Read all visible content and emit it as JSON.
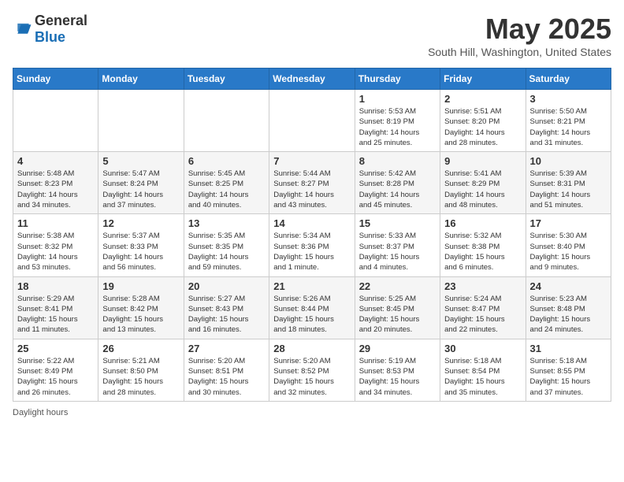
{
  "header": {
    "logo_general": "General",
    "logo_blue": "Blue",
    "month_title": "May 2025",
    "location": "South Hill, Washington, United States"
  },
  "days_of_week": [
    "Sunday",
    "Monday",
    "Tuesday",
    "Wednesday",
    "Thursday",
    "Friday",
    "Saturday"
  ],
  "weeks": [
    [
      {
        "day": "",
        "info": ""
      },
      {
        "day": "",
        "info": ""
      },
      {
        "day": "",
        "info": ""
      },
      {
        "day": "",
        "info": ""
      },
      {
        "day": "1",
        "info": "Sunrise: 5:53 AM\nSunset: 8:19 PM\nDaylight: 14 hours\nand 25 minutes."
      },
      {
        "day": "2",
        "info": "Sunrise: 5:51 AM\nSunset: 8:20 PM\nDaylight: 14 hours\nand 28 minutes."
      },
      {
        "day": "3",
        "info": "Sunrise: 5:50 AM\nSunset: 8:21 PM\nDaylight: 14 hours\nand 31 minutes."
      }
    ],
    [
      {
        "day": "4",
        "info": "Sunrise: 5:48 AM\nSunset: 8:23 PM\nDaylight: 14 hours\nand 34 minutes."
      },
      {
        "day": "5",
        "info": "Sunrise: 5:47 AM\nSunset: 8:24 PM\nDaylight: 14 hours\nand 37 minutes."
      },
      {
        "day": "6",
        "info": "Sunrise: 5:45 AM\nSunset: 8:25 PM\nDaylight: 14 hours\nand 40 minutes."
      },
      {
        "day": "7",
        "info": "Sunrise: 5:44 AM\nSunset: 8:27 PM\nDaylight: 14 hours\nand 43 minutes."
      },
      {
        "day": "8",
        "info": "Sunrise: 5:42 AM\nSunset: 8:28 PM\nDaylight: 14 hours\nand 45 minutes."
      },
      {
        "day": "9",
        "info": "Sunrise: 5:41 AM\nSunset: 8:29 PM\nDaylight: 14 hours\nand 48 minutes."
      },
      {
        "day": "10",
        "info": "Sunrise: 5:39 AM\nSunset: 8:31 PM\nDaylight: 14 hours\nand 51 minutes."
      }
    ],
    [
      {
        "day": "11",
        "info": "Sunrise: 5:38 AM\nSunset: 8:32 PM\nDaylight: 14 hours\nand 53 minutes."
      },
      {
        "day": "12",
        "info": "Sunrise: 5:37 AM\nSunset: 8:33 PM\nDaylight: 14 hours\nand 56 minutes."
      },
      {
        "day": "13",
        "info": "Sunrise: 5:35 AM\nSunset: 8:35 PM\nDaylight: 14 hours\nand 59 minutes."
      },
      {
        "day": "14",
        "info": "Sunrise: 5:34 AM\nSunset: 8:36 PM\nDaylight: 15 hours\nand 1 minute."
      },
      {
        "day": "15",
        "info": "Sunrise: 5:33 AM\nSunset: 8:37 PM\nDaylight: 15 hours\nand 4 minutes."
      },
      {
        "day": "16",
        "info": "Sunrise: 5:32 AM\nSunset: 8:38 PM\nDaylight: 15 hours\nand 6 minutes."
      },
      {
        "day": "17",
        "info": "Sunrise: 5:30 AM\nSunset: 8:40 PM\nDaylight: 15 hours\nand 9 minutes."
      }
    ],
    [
      {
        "day": "18",
        "info": "Sunrise: 5:29 AM\nSunset: 8:41 PM\nDaylight: 15 hours\nand 11 minutes."
      },
      {
        "day": "19",
        "info": "Sunrise: 5:28 AM\nSunset: 8:42 PM\nDaylight: 15 hours\nand 13 minutes."
      },
      {
        "day": "20",
        "info": "Sunrise: 5:27 AM\nSunset: 8:43 PM\nDaylight: 15 hours\nand 16 minutes."
      },
      {
        "day": "21",
        "info": "Sunrise: 5:26 AM\nSunset: 8:44 PM\nDaylight: 15 hours\nand 18 minutes."
      },
      {
        "day": "22",
        "info": "Sunrise: 5:25 AM\nSunset: 8:45 PM\nDaylight: 15 hours\nand 20 minutes."
      },
      {
        "day": "23",
        "info": "Sunrise: 5:24 AM\nSunset: 8:47 PM\nDaylight: 15 hours\nand 22 minutes."
      },
      {
        "day": "24",
        "info": "Sunrise: 5:23 AM\nSunset: 8:48 PM\nDaylight: 15 hours\nand 24 minutes."
      }
    ],
    [
      {
        "day": "25",
        "info": "Sunrise: 5:22 AM\nSunset: 8:49 PM\nDaylight: 15 hours\nand 26 minutes."
      },
      {
        "day": "26",
        "info": "Sunrise: 5:21 AM\nSunset: 8:50 PM\nDaylight: 15 hours\nand 28 minutes."
      },
      {
        "day": "27",
        "info": "Sunrise: 5:20 AM\nSunset: 8:51 PM\nDaylight: 15 hours\nand 30 minutes."
      },
      {
        "day": "28",
        "info": "Sunrise: 5:20 AM\nSunset: 8:52 PM\nDaylight: 15 hours\nand 32 minutes."
      },
      {
        "day": "29",
        "info": "Sunrise: 5:19 AM\nSunset: 8:53 PM\nDaylight: 15 hours\nand 34 minutes."
      },
      {
        "day": "30",
        "info": "Sunrise: 5:18 AM\nSunset: 8:54 PM\nDaylight: 15 hours\nand 35 minutes."
      },
      {
        "day": "31",
        "info": "Sunrise: 5:18 AM\nSunset: 8:55 PM\nDaylight: 15 hours\nand 37 minutes."
      }
    ]
  ],
  "footer": {
    "daylight_label": "Daylight hours"
  }
}
